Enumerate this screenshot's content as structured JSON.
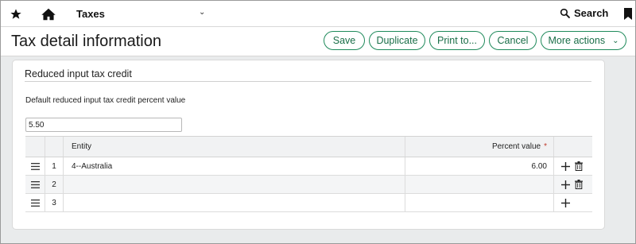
{
  "topbar": {
    "module_title": "Taxes",
    "search_label": "Search"
  },
  "header": {
    "title": "Tax detail information",
    "buttons": {
      "save": "Save",
      "duplicate": "Duplicate",
      "print": "Print to...",
      "cancel": "Cancel",
      "more": "More actions"
    }
  },
  "section": {
    "title": "Reduced input tax credit",
    "field_label": "Default reduced input tax credit percent value",
    "field_value": "5.50"
  },
  "grid": {
    "columns": [
      "Entity",
      "Percent value"
    ],
    "rows": [
      {
        "num": "1",
        "entity": "4--Australia",
        "percent": "6.00"
      },
      {
        "num": "2",
        "entity": "",
        "percent": ""
      },
      {
        "num": "3",
        "entity": "",
        "percent": ""
      }
    ]
  },
  "colors": {
    "accent_green": "#1f8a5b",
    "required_red": "#c0392b"
  },
  "icons": [
    "star-icon",
    "home-icon",
    "chevron-down-icon",
    "search-icon",
    "bookmark-icon",
    "drag-handle-icon",
    "plus-icon",
    "trash-icon"
  ]
}
